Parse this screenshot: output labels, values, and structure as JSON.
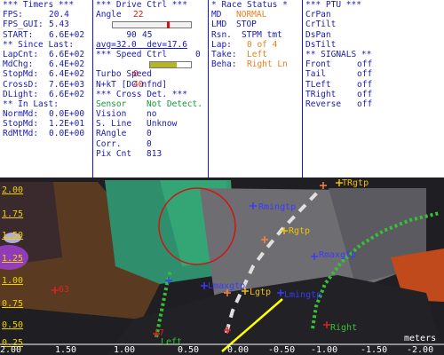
{
  "timers": {
    "title": "*** Timers ***",
    "rows": [
      {
        "label": "FPS:",
        "value": "20.4"
      },
      {
        "label": "FPS_GUI:",
        "value": "5.43"
      },
      {
        "label": "START:",
        "value": "6.6E+02"
      }
    ],
    "since_title": "** Since Last:",
    "since_rows": [
      {
        "label": "LapCnt:",
        "value": "6.6E+02"
      },
      {
        "label": "MdChg:",
        "value": "6.4E+02"
      },
      {
        "label": "StopMd:",
        "value": "6.4E+02"
      },
      {
        "label": "CrossD:",
        "value": "7.6E+03"
      },
      {
        "label": "DLight:",
        "value": "6.6E+02"
      }
    ],
    "in_title": "** In Last:",
    "in_rows": [
      {
        "label": "NormMd:",
        "value": "0.0E+00"
      },
      {
        "label": "StopMd:",
        "value": "1.2E+01"
      },
      {
        "label": "RdMtMd:",
        "value": "0.0E+00"
      }
    ]
  },
  "drive_ctrl": {
    "title": "*** Drive Ctrl ***",
    "angle_label": "Angle",
    "angle_value": "22",
    "scale_min": "90",
    "scale_max": "0",
    "scale_mid": "45",
    "scale_fill": 0.71,
    "avg_dev": "avg=32.0  dev=17.6",
    "speed_title": "*** Speed Ctrl",
    "speed_label": "Speed",
    "speed_value": "40",
    "speed_fill": 0.65,
    "turbo_label": "Turbo",
    "turbo_value": "0",
    "mode": "N+kT [DC nfnd]",
    "cross_title": "*** Cross Det. ***",
    "cross_rows": [
      {
        "label": "Sensor",
        "value": "Not Detect."
      },
      {
        "label": "Vision",
        "value": "no"
      },
      {
        "label": "S. Line",
        "value": "Unknow"
      },
      {
        "label": "RAngle",
        "value": "0"
      },
      {
        "label": "Corr.",
        "value": "0"
      },
      {
        "label": "Pix Cnt",
        "value": "813"
      }
    ]
  },
  "race_status": {
    "title": "* Race Status *",
    "rows": [
      {
        "label": "MD",
        "value": "NORMAL"
      },
      {
        "label": "LMD",
        "value": "STOP"
      },
      {
        "label": "Rsn.",
        "value": "STPM tmt"
      },
      {
        "label": "Lap:",
        "value": "0 of 4"
      },
      {
        "label": "Take:",
        "value": "Left"
      },
      {
        "label": "Beha:",
        "value": "Right Ln"
      }
    ]
  },
  "ptu": {
    "title": "*** PTU ***",
    "items": [
      "CrPan",
      "CrTilt",
      "DsPan",
      "DsTilt"
    ],
    "signals_title": "** SIGNALS **",
    "signals": [
      {
        "label": "Front",
        "value": "off"
      },
      {
        "label": "Tail",
        "value": "off"
      },
      {
        "label": "TLeft",
        "value": "off"
      },
      {
        "label": "TRight",
        "value": "off"
      },
      {
        "label": "Reverse",
        "value": "off"
      }
    ]
  },
  "camera": {
    "y_labels": [
      "2.00",
      "1.75",
      "1.50",
      "1.25",
      "1.00",
      "0.75",
      "0.50",
      "0.25"
    ],
    "x_labels": [
      "2.00",
      "1.50",
      "1.00",
      "0.50",
      "0.00",
      "-0.50",
      "-1.00",
      "-1.50",
      "-2.00"
    ],
    "unit": "meters",
    "markers": {
      "trgtp": "TRgtp",
      "rmingtp": "Rmingtp",
      "rgtp": "Rgtp",
      "rmaxgtp": "Rmaxgtp",
      "lmaxgtp": "Lmaxgtp",
      "lgtp": "Lgtp",
      "lmingtp": "Lmingtp",
      "left": "Left",
      "right": "Right",
      "n63": "63",
      "n7": "7"
    }
  }
}
